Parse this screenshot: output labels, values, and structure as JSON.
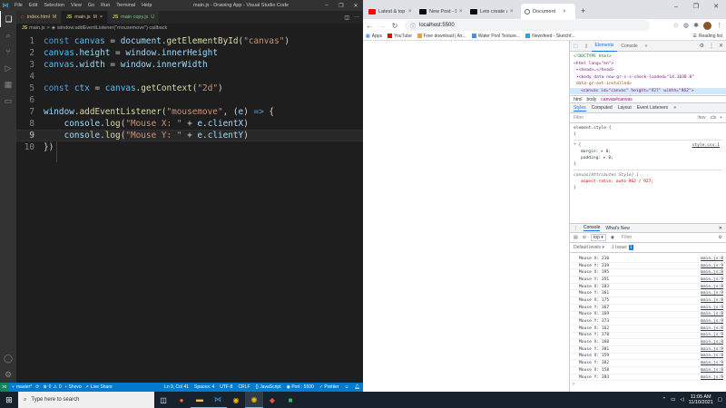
{
  "vscode": {
    "menu": [
      "File",
      "Edit",
      "Selection",
      "View",
      "Go",
      "Run",
      "Terminal",
      "Help"
    ],
    "window_title": "main.js - Drawing App - Visual Studio Code",
    "tabs": [
      {
        "name": "index.html",
        "state": "M"
      },
      {
        "name": "main.js",
        "state": "M"
      },
      {
        "name": "main copy.js",
        "state": "U"
      }
    ],
    "breadcrumb": [
      "main.js",
      ">",
      "window.addEventListener(\"mousemove\") callback"
    ],
    "code_lines": [
      {
        "num": "1",
        "text": "const canvas = document.getElementById(\"canvas\")"
      },
      {
        "num": "2",
        "text": "canvas.height = window.innerHeight"
      },
      {
        "num": "3",
        "text": "canvas.width = window.innerWidth"
      },
      {
        "num": "4",
        "text": ""
      },
      {
        "num": "5",
        "text": "const ctx = canvas.getContext(\"2d\")"
      },
      {
        "num": "6",
        "text": ""
      },
      {
        "num": "7",
        "text": "window.addEventListener(\"mousemove\", (e) => {"
      },
      {
        "num": "8",
        "text": "    console.log(\"Mouse X: \" + e.clientX)"
      },
      {
        "num": "9",
        "text": "    console.log(\"Mouse Y: \" + e.clientY)"
      },
      {
        "num": "10",
        "text": "})"
      }
    ],
    "status": {
      "branch": "master*",
      "errors": "0",
      "warnings": "0",
      "shovo": "Shovo",
      "live_share": "Live Share",
      "position": "Ln 9, Col 41",
      "spaces": "Spaces: 4",
      "encoding": "UTF-8",
      "eol": "CRLF",
      "language": "JavaScript",
      "port": "Port : 5500",
      "prettier": "Prettier"
    }
  },
  "chrome": {
    "tabs": [
      {
        "title": "Latest & top vi...",
        "icon": "youtube"
      },
      {
        "title": "New Post - DEV Co...",
        "icon": "dev"
      },
      {
        "title": "Lets create a scree...",
        "icon": "dev"
      },
      {
        "title": "Document",
        "icon": "globe"
      }
    ],
    "url": "localhost:5500",
    "bookmarks": [
      "Apps",
      "YouTube",
      "Free download | As...",
      "Water Pool Texture...",
      "Newsfeed - Sketchf..."
    ],
    "reading_list": "Reading list",
    "devtools": {
      "top_tabs": [
        "Elements",
        "Console"
      ],
      "more_tabs": "»",
      "elements": [
        "<!DOCTYPE html>",
        "<html lang=\"en\">",
        "▸<head>…</head>",
        "▾<body data-new-gr-c-s-check-loaded=\"14.1038.0\"",
        "data-gr-ext-installed>",
        "<canvas id=\"canvas\" height=\"927\" width=\"962\">"
      ],
      "dom_crumbs": [
        "html",
        "body",
        "canvas#canvas"
      ],
      "style_tabs": [
        "Styles",
        "Computed",
        "Layout",
        "Event Listeners",
        "»"
      ],
      "filter_placeholder": "Filter",
      "filter_right": [
        ":hov",
        ".cls",
        "+"
      ],
      "styles": {
        "element_style": "element.style {",
        "close": "}",
        "star_selector": "* {",
        "style_link": "style.css:1",
        "margin": "margin: ▸ 0;",
        "padding": "padding: ▸ 0;",
        "attr_style": "canvas[Attributes Style] {",
        "aspect": "aspect-ratio: auto 962 / 927;"
      },
      "drawer_tabs": [
        "Console",
        "What's New"
      ],
      "context": "top ▾",
      "console_filter": "Filter",
      "default_levels": "Default levels ▾",
      "issues": "1 Issue:",
      "issues_count": "1",
      "logs": [
        {
          "text": "Mouse X: 210",
          "src": "main.js:8"
        },
        {
          "text": "Mouse Y: 339",
          "src": "main.js:9"
        },
        {
          "text": "Mouse X: 195",
          "src": "main.js:8"
        },
        {
          "text": "Mouse Y: 351",
          "src": "main.js:9"
        },
        {
          "text": "Mouse X: 183",
          "src": "main.js:8"
        },
        {
          "text": "Mouse Y: 361",
          "src": "main.js:9"
        },
        {
          "text": "Mouse X: 175",
          "src": "main.js:8"
        },
        {
          "text": "Mouse Y: 367",
          "src": "main.js:9"
        },
        {
          "text": "Mouse X: 169",
          "src": "main.js:8"
        },
        {
          "text": "Mouse Y: 373",
          "src": "main.js:9"
        },
        {
          "text": "Mouse X: 162",
          "src": "main.js:8"
        },
        {
          "text": "Mouse Y: 378",
          "src": "main.js:9"
        },
        {
          "text": "Mouse X: 160",
          "src": "main.js:8"
        },
        {
          "text": "Mouse Y: 381",
          "src": "main.js:9"
        },
        {
          "text": "Mouse X: 159",
          "src": "main.js:8"
        },
        {
          "text": "Mouse Y: 382",
          "src": "main.js:9"
        },
        {
          "text": "Mouse X: 158",
          "src": "main.js:8"
        },
        {
          "text": "Mouse Y: 383",
          "src": "main.js:9"
        }
      ]
    }
  },
  "taskbar": {
    "search_placeholder": "Type here to search",
    "time": "11:05 AM",
    "date": "11/10/2021"
  }
}
